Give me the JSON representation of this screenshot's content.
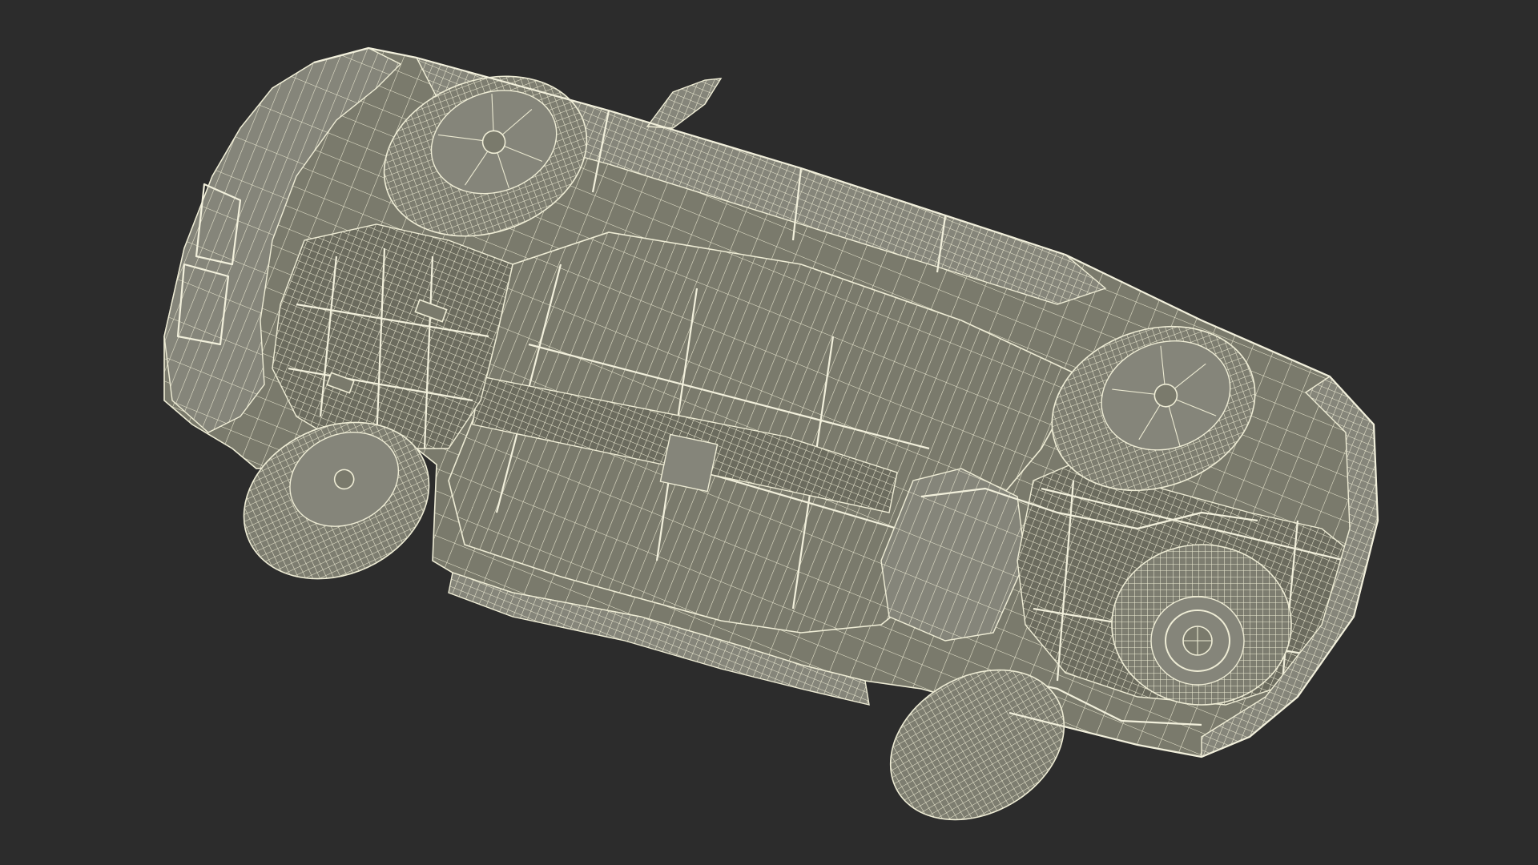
{
  "scene": {
    "subject": "car-underside-wireframe",
    "background_color": "#2c2c2c",
    "model_fill_color": "#7a7a6c",
    "wire_color": "#ecead2"
  }
}
